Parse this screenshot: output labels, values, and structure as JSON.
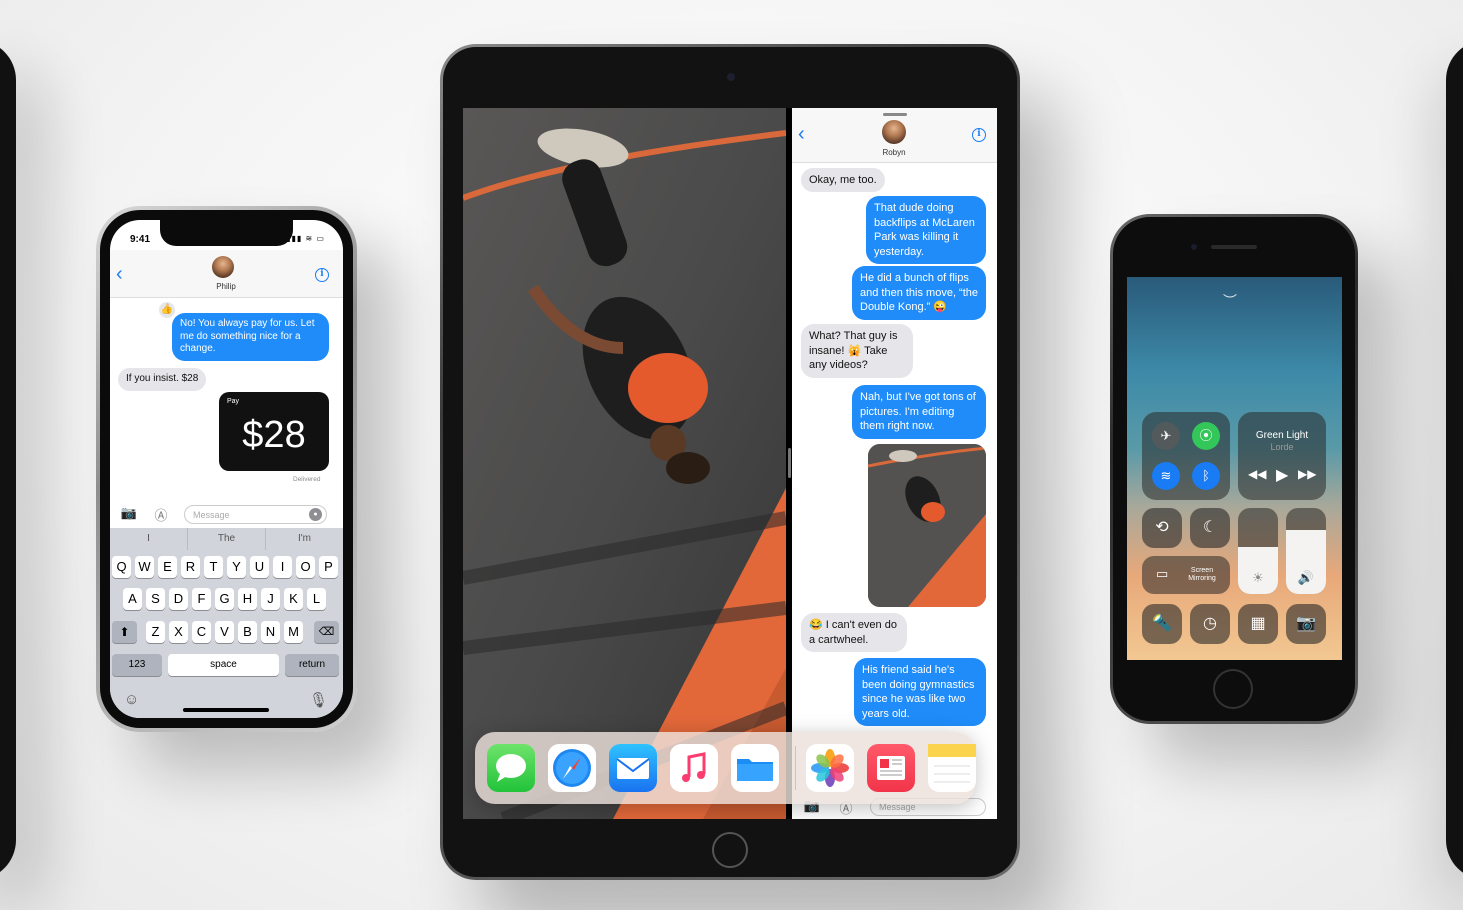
{
  "iphone_x": {
    "status_time": "9:41",
    "status_icons": "▮▮▮ ≋ ▭",
    "contact_name": "Philip",
    "messages": {
      "m1": "No! You always pay for us. Let me do something nice for a change.",
      "m2": "If you insist. $28"
    },
    "apple_pay": {
      "label": " Pay",
      "amount": "$28"
    },
    "delivered": "Delivered",
    "input_placeholder": "Message",
    "suggestions": [
      "I",
      "The",
      "I'm"
    ],
    "keys": {
      "row1": [
        "Q",
        "W",
        "E",
        "R",
        "T",
        "Y",
        "U",
        "I",
        "O",
        "P"
      ],
      "row2": [
        "A",
        "S",
        "D",
        "F",
        "G",
        "H",
        "J",
        "K",
        "L"
      ],
      "row3": [
        "Z",
        "X",
        "C",
        "V",
        "B",
        "N",
        "M"
      ],
      "numbers": "123",
      "space": "space",
      "return": "return"
    }
  },
  "ipad": {
    "contact_name": "Robyn",
    "messages": {
      "m1": "Okay, me too.",
      "m2": "That dude doing backflips at McLaren Park was killing it yesterday.",
      "m3": "He did a bunch of flips and then this move, “the Double Kong.” 😜",
      "m4": "What? That guy is insane! 🙀 Take any videos?",
      "m5": "Nah, but I've got tons of pictures. I'm editing them right now.",
      "m6": "😂 I can't even do a cartwheel.",
      "m7": "His friend said he's been doing gymnastics since he was like two years old."
    },
    "input_placeholder": "Message",
    "dock_apps": [
      "messages-app-icon",
      "safari-app-icon",
      "mail-app-icon",
      "music-app-icon",
      "files-app-icon",
      "photos-app-icon",
      "news-app-icon",
      "notes-app-icon"
    ]
  },
  "iphone_8": {
    "now_playing": {
      "title": "Green Light",
      "artist": "Lorde"
    },
    "screen_mirroring": "Screen Mirroring",
    "brightness_level": 0.55,
    "volume_level": 0.75
  },
  "colors": {
    "imessage_blue": "#1f8cf9",
    "ios_blue": "#1a7cf5",
    "bubble_gray": "#e6e6ea"
  }
}
